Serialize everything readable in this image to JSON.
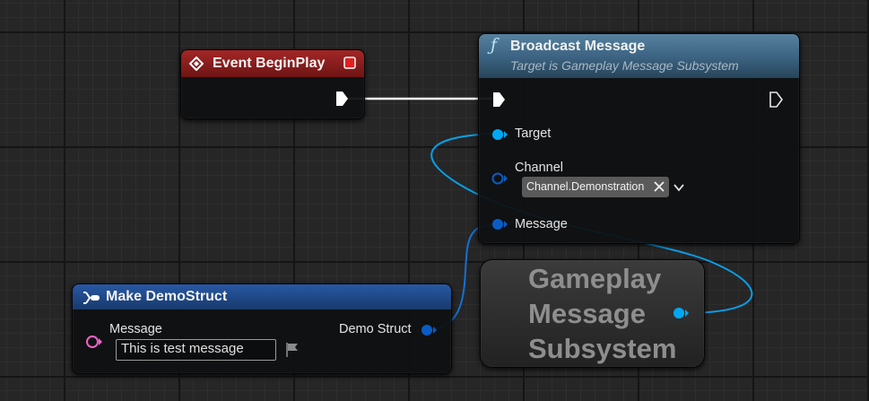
{
  "event_begin_play": {
    "title": "Event BeginPlay"
  },
  "broadcast_message": {
    "title": "Broadcast Message",
    "subtitle": "Target is Gameplay Message Subsystem",
    "pins": {
      "target": "Target",
      "channel": "Channel",
      "message": "Message"
    },
    "channel_value": "Channel.Demonstration"
  },
  "make_demo_struct": {
    "title": "Make DemoStruct",
    "input_label": "Message",
    "input_value": "This is test message",
    "output_label": "Demo Struct"
  },
  "gameplay_message_subsystem": {
    "lines": [
      "Gameplay",
      "Message",
      "Subsystem"
    ]
  },
  "colors": {
    "exec_wire": "#ffffff",
    "object_pin": "#00a8f4",
    "struct_pin": "#0058c8",
    "string_pin": "#f062c8",
    "event_header": "#8e1b1b",
    "function_header": "#4a7a9a",
    "struct_header": "#1c4880"
  },
  "icons": [
    "event-diamond-icon",
    "delegate-square-icon",
    "function-icon",
    "make-struct-icon",
    "clear-x-icon",
    "chevron-down-icon",
    "flag-icon"
  ]
}
